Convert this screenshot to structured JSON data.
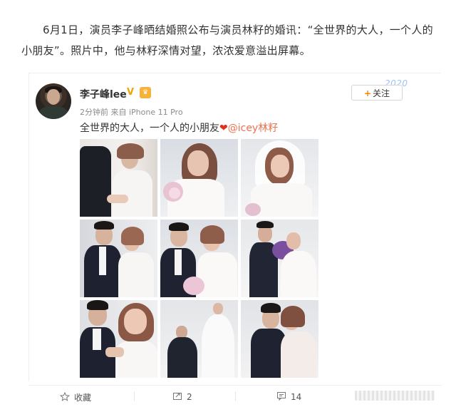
{
  "article": {
    "text": "6月1日，演员李子峰晒结婚照公布与演员林籽的婚讯：“全世界的大人，一个人的小朋友”。照片中，他与林籽深情对望，浓浓爱意溢出屏幕。"
  },
  "post": {
    "username": "李子峰lee",
    "verified_badge": "V",
    "meta": "2分钟前 来自 iPhone 11 Pro",
    "decoration": "2020",
    "follow_label": "关注",
    "text": "全世界的大人，一个人的小朋友",
    "heart": "❤",
    "mention": "@icey林籽"
  },
  "actions": {
    "favorite_label": "收藏",
    "repost_count": "2",
    "comment_count": "14"
  },
  "colors": {
    "accent_orange": "#ff8200",
    "mention": "#eb7350",
    "verified": "#f0a400",
    "meta_gray": "#8b8b8b"
  }
}
